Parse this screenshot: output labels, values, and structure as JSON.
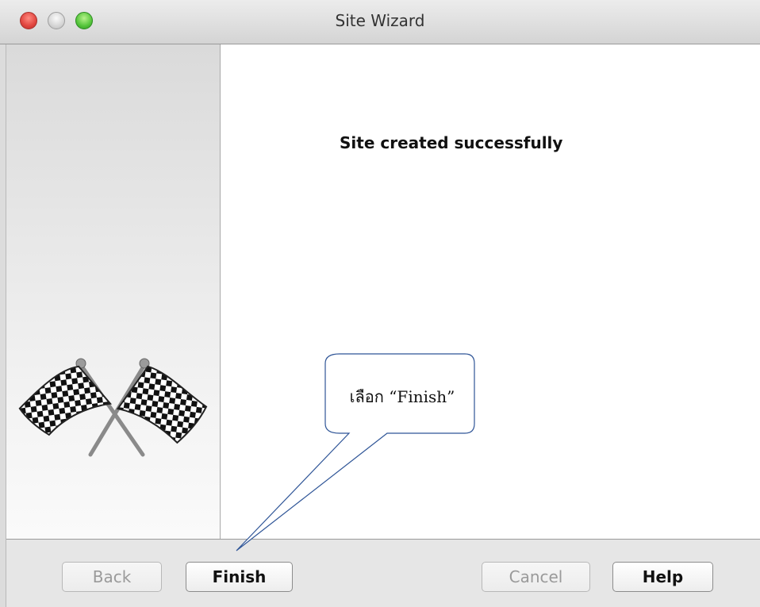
{
  "window": {
    "title": "Site Wizard"
  },
  "content": {
    "message": "Site created successfully"
  },
  "annotation": {
    "text": "เลือก “Finish”"
  },
  "buttons": {
    "back": "Back",
    "finish": "Finish",
    "cancel": "Cancel",
    "help": "Help"
  },
  "icons": {
    "close": "close-traffic-light",
    "minimize": "minimize-traffic-light",
    "zoom": "zoom-traffic-light",
    "flags": "checkered-flags-icon"
  },
  "colors": {
    "close": "#e0443e",
    "zoom": "#54c43a",
    "callout_stroke": "#2f5597"
  }
}
